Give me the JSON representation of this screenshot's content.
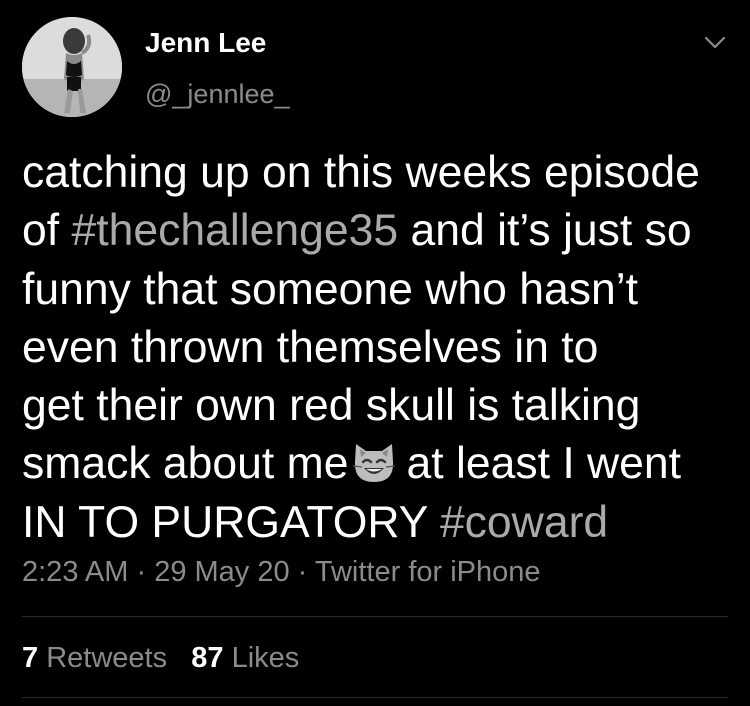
{
  "user": {
    "name": "Jenn Lee",
    "handle": "@_jennlee_"
  },
  "tweet": {
    "line1": "catching up on this weeks episode",
    "line2_a": "of ",
    "hashtag1": "#thechallenge35",
    "line2_b": " and it’s just so",
    "line3": "funny that someone who hasn’t",
    "line4": "even thrown themselves in to",
    "line5": "get their own red skull is talking",
    "line6_a": "smack about me",
    "line6_b": "at least I went",
    "line7_a": "IN TO PURGATORY ",
    "hashtag2": "#coward"
  },
  "meta": {
    "time": "2:23 AM",
    "sep1": " · ",
    "date": "29 May 20",
    "sep2": " · ",
    "source": "Twitter for iPhone"
  },
  "stats": {
    "retweets_count": "7",
    "retweets_label": "Retweets",
    "likes_count": "87",
    "likes_label": "Likes"
  },
  "icons": {
    "menu": "chevron-down-icon",
    "emoji": "grinning-cat-emoji"
  },
  "colors": {
    "background": "#000000",
    "text": "#ffffff",
    "secondary": "#8b8b8b",
    "hashtag": "#aaaaaa"
  }
}
